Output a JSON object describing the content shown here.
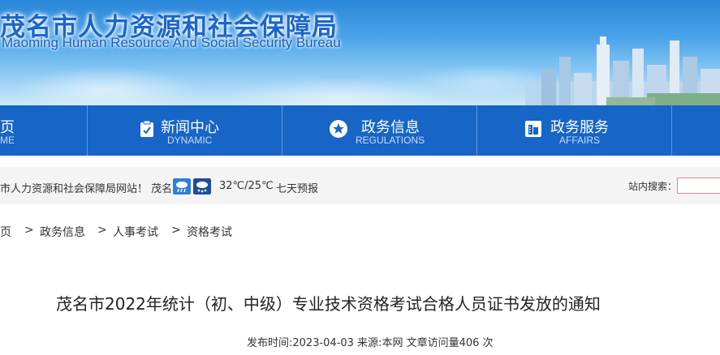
{
  "header": {
    "title_cn": "茂名市人力资源和社会保障局",
    "title_en": "Maoming Human Resource And Social Security Bureau"
  },
  "nav": [
    {
      "cn": "页",
      "en": "ME",
      "icon": "home-icon"
    },
    {
      "cn": "新闻中心",
      "en": "DYNAMIC",
      "icon": "clipboard-check-icon"
    },
    {
      "cn": "政务信息",
      "en": "REGULATIONS",
      "icon": "star-badge-icon"
    },
    {
      "cn": "政务服务",
      "en": "AFFAIRS",
      "icon": "building-icon"
    }
  ],
  "info": {
    "welcome": "市人力资源和社会保障局网站！ 茂名",
    "weather_icons": [
      "rain-icon",
      "snow-icon"
    ],
    "temperature": "32℃/25℃",
    "forecast_link": "七天预报",
    "search_label": "站内搜索："
  },
  "breadcrumb": [
    "页",
    "政务信息",
    "人事考试",
    "资格考试"
  ],
  "breadcrumb_sep": ">",
  "article": {
    "title": "茂名市2022年统计（初、中级）专业技术资格考试合格人员证书发放的通知",
    "meta": "发布时间:2023-04-03    来源:本网    文章访问量406 次"
  },
  "colors": {
    "nav_bg": "#1765c6",
    "title_blue": "#1a66c9",
    "weather_icon_bg": "#2d7fd8"
  }
}
